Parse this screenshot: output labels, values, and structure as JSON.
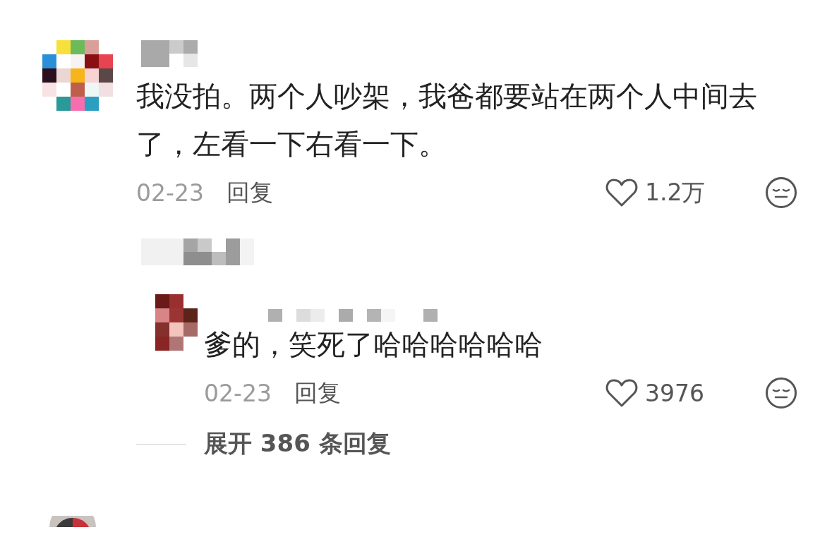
{
  "comments": [
    {
      "text": "我没拍。两个人吵架，我爸都要站在两个人中间去了，左看一下右看一下。",
      "date": "02-23",
      "reply_label": "回复",
      "likes": "1.2万",
      "replies": [
        {
          "text": "爹的，笑死了哈哈哈哈哈哈",
          "date": "02-23",
          "reply_label": "回复",
          "likes": "3976"
        }
      ],
      "expand_label": "展开 386 条回复"
    }
  ]
}
